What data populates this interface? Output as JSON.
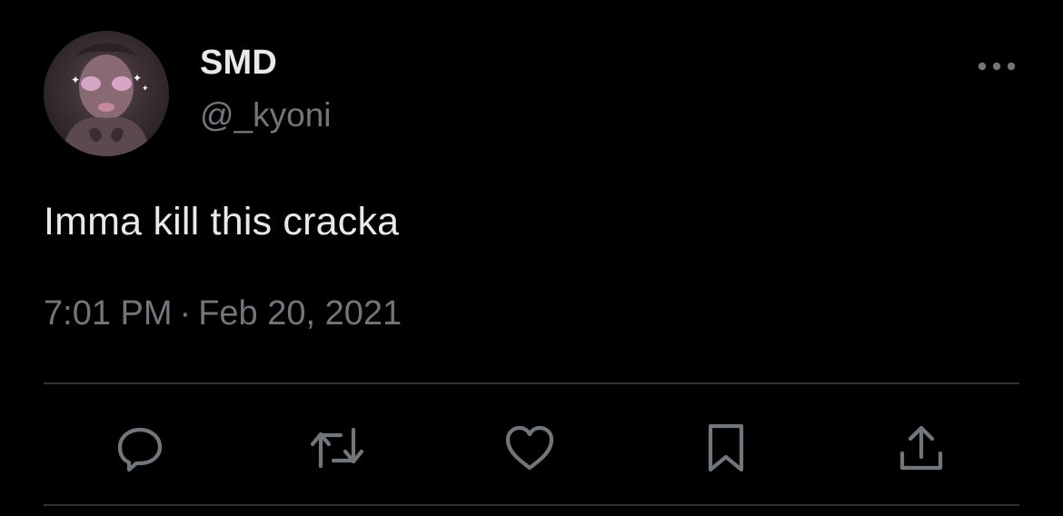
{
  "tweet": {
    "author": {
      "display_name": "SMD",
      "handle": "@_kyoni"
    },
    "text": "Imma kill this cracka",
    "time": "7:01 PM",
    "separator": "·",
    "date": "Feb 20, 2021"
  },
  "actions": [
    {
      "name": "reply",
      "icon": "reply-icon"
    },
    {
      "name": "retweet",
      "icon": "retweet-icon"
    },
    {
      "name": "like",
      "icon": "heart-icon"
    },
    {
      "name": "bookmark",
      "icon": "bookmark-icon"
    },
    {
      "name": "share",
      "icon": "share-icon"
    }
  ],
  "colors": {
    "background": "#000000",
    "primary_text": "#e7e9ea",
    "secondary_text": "#71767b",
    "divider": "#2f3336"
  }
}
